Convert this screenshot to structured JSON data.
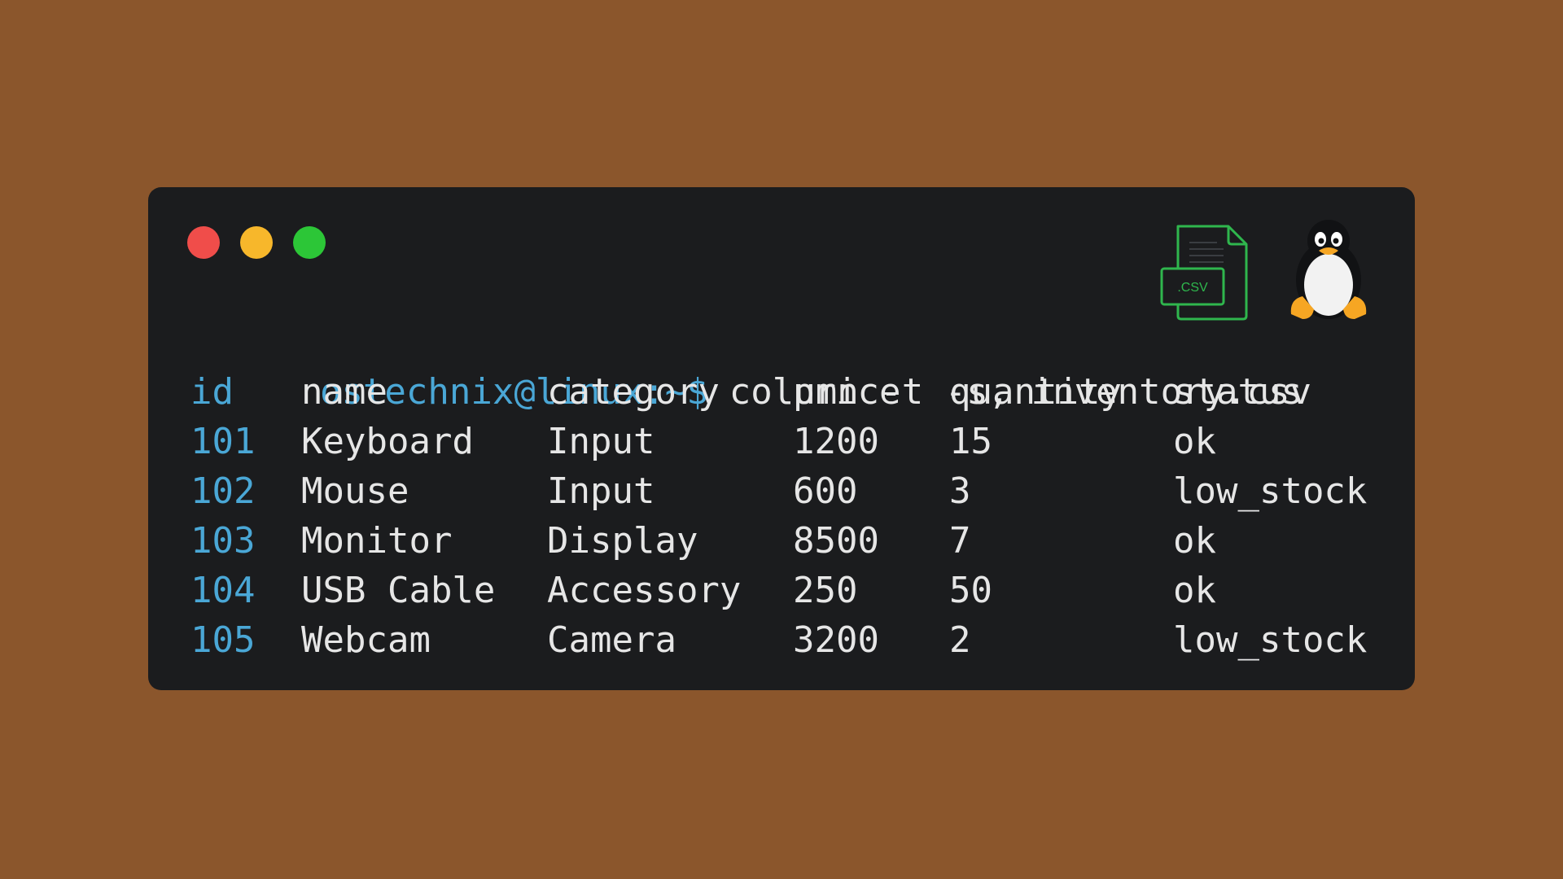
{
  "window": {
    "traffic_lights": [
      "#f04d4a",
      "#f7b72b",
      "#2cc637"
    ],
    "background": "#1b1c1e",
    "csv_badge": ".CSV"
  },
  "terminal": {
    "prompt": "ostechnix@linux:~$",
    "command": "column -t -s, inventory.csv",
    "headers": [
      "id",
      "name",
      "category",
      "price",
      "quantity",
      "status"
    ],
    "rows": [
      [
        "101",
        "Keyboard",
        "Input",
        "1200",
        "15",
        "ok"
      ],
      [
        "102",
        "Mouse",
        "Input",
        "600",
        "3",
        "low_stock"
      ],
      [
        "103",
        "Monitor",
        "Display",
        "8500",
        "7",
        "ok"
      ],
      [
        "104",
        "USB Cable",
        "Accessory",
        "250",
        "50",
        "ok"
      ],
      [
        "105",
        "Webcam",
        "Camera",
        "3200",
        "2",
        "low_stock"
      ]
    ]
  },
  "colors": {
    "page_background": "#8b562c",
    "prompt": "#4aa7d6",
    "text": "#e6e6e6",
    "csv_icon": "#2fb64d"
  },
  "icons": [
    "csv-file-icon",
    "tux-penguin-icon"
  ]
}
